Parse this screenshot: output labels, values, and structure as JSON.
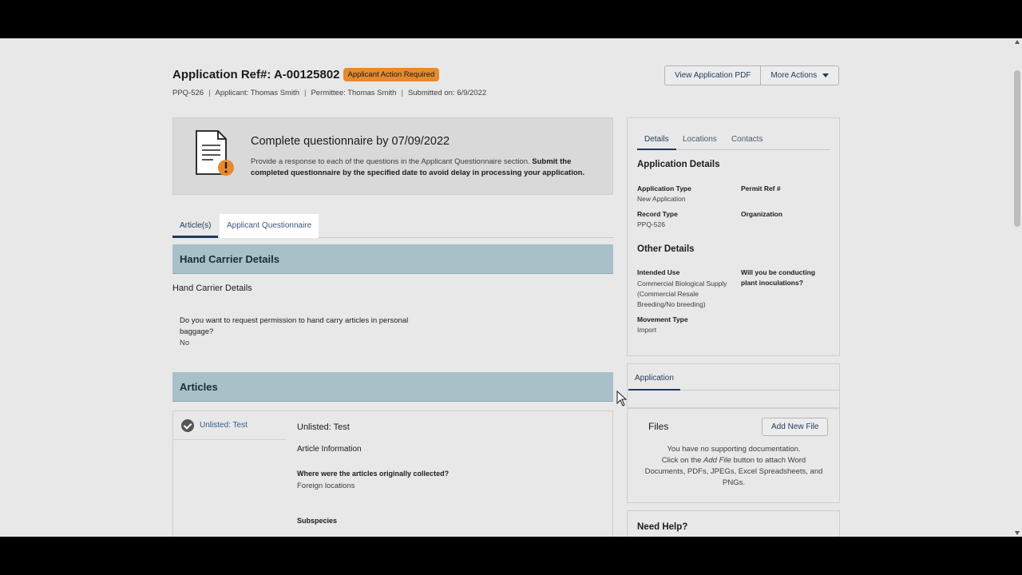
{
  "header": {
    "title": "Application Ref#: A-00125802",
    "badge": "Applicant Action Required",
    "meta": {
      "form": "PPQ-526",
      "applicant": "Applicant: Thomas Smith",
      "permittee": "Permittee: Thomas Smith",
      "submitted": "Submitted on: 6/9/2022"
    },
    "actions": {
      "view_pdf": "View Application PDF",
      "more_actions": "More Actions"
    }
  },
  "notice": {
    "heading": "Complete questionnaire by 07/09/2022",
    "text": "Provide a response to each of the questions in the Applicant Questionnaire section.",
    "text_bold": "Submit the completed questionnaire by the specified date to avoid delay in processing your application."
  },
  "main_tabs": [
    "Article(s)",
    "Applicant Questionnaire"
  ],
  "hand_carrier": {
    "section_title": "Hand Carrier Details",
    "sub_heading": "Hand Carrier Details",
    "question": "Do you want to request permission to hand carry articles in personal baggage?",
    "answer": "No"
  },
  "articles": {
    "section_title": "Articles",
    "list_item": "Unlisted: Test",
    "title": "Unlisted: Test",
    "info_heading": "Article Information",
    "question": "Where were the articles originally collected?",
    "answer": "Foreign locations",
    "subspecies_label": "Subspecies"
  },
  "side": {
    "tabs": [
      "Details",
      "Locations",
      "Contacts"
    ],
    "app_details_heading": "Application Details",
    "app_type_label": "Application Type",
    "app_type_value": "New Application",
    "permit_ref_label": "Permit Ref #",
    "record_type_label": "Record Type",
    "record_type_value": "PPQ-526",
    "organization_label": "Organization",
    "other_details_heading": "Other Details",
    "intended_use_label": "Intended Use",
    "intended_use_value": "Commercial Biological Supply (Commercial Resale Breeding/No breeding)",
    "inoculation_label": "Will you be conducting plant inoculations?",
    "movement_type_label": "Movement Type",
    "movement_type_value": "Import"
  },
  "application_panel": {
    "tab": "Application",
    "files_title": "Files",
    "add_file_button": "Add New File",
    "empty_line1": "You have no supporting documentation.",
    "empty_line2_pre": "Click on the ",
    "empty_line2_em": "Add File",
    "empty_line2_post": " button to attach Word Documents, PDFs, JPEGs, Excel Spreadsheets, and PNGs."
  },
  "help": {
    "heading": "Need Help?"
  },
  "colors": {
    "badge": "#e58a2d",
    "section_bar": "#a8c0c8",
    "link": "#1f3a5c"
  }
}
